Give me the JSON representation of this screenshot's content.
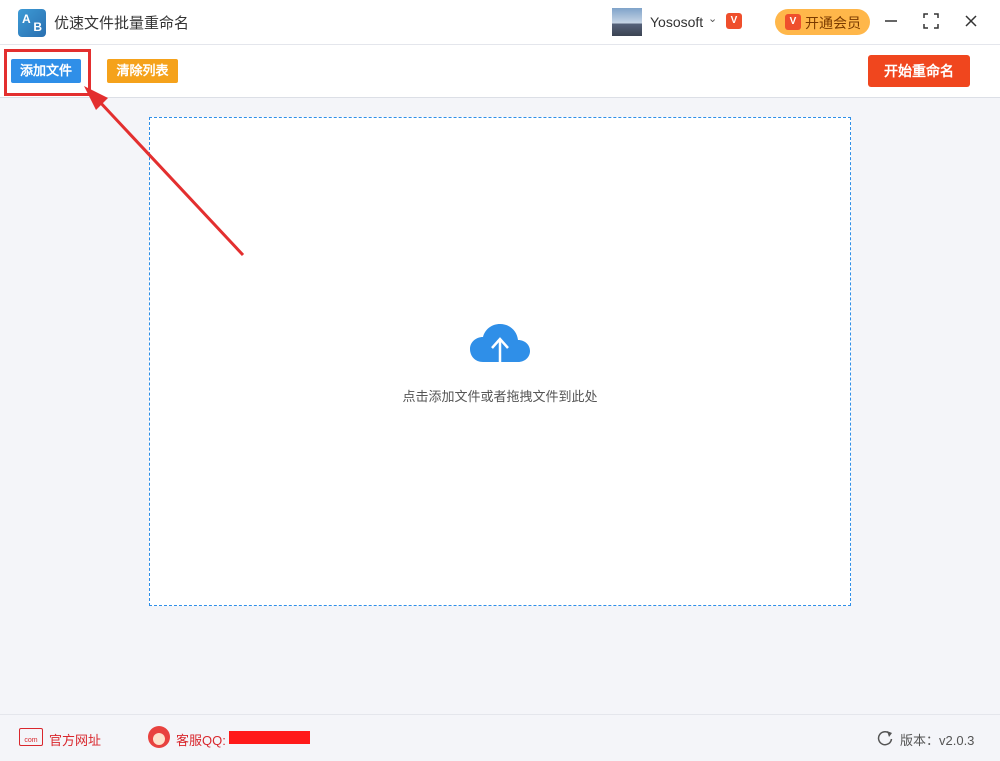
{
  "window": {
    "title": "优速文件批量重命名",
    "logo_letters": [
      "A",
      "B"
    ],
    "user": {
      "name": "Yososoft",
      "vip_mark": "V"
    },
    "vip_button": {
      "label": "开通会员",
      "mark": "V"
    }
  },
  "toolbar": {
    "add_label": "添加文件",
    "clear_label": "清除列表",
    "start_label": "开始重命名"
  },
  "dropzone": {
    "hint": "点击添加文件或者拖拽文件到此处",
    "icon": "cloud-upload-icon"
  },
  "statusbar": {
    "site_icon_text": "com",
    "site_label": "官方网址",
    "qq_label": "客服QQ:",
    "version_label": "版本：v2.0.3"
  },
  "colors": {
    "primary": "#2f8fe8",
    "clear": "#f5a21b",
    "start": "#f0461e",
    "vip": "#ffb74a",
    "annotation": "#e32f2f"
  }
}
